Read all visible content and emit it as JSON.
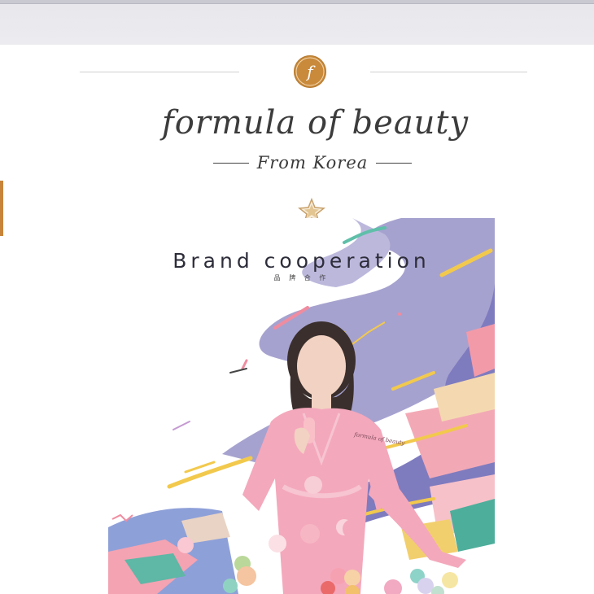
{
  "header": {
    "logo_letter": "f",
    "title": "formula of beauty",
    "subtitle": "From Korea"
  },
  "poster": {
    "heading": "Brand cooperation",
    "heading_cn": "品 牌 合 作",
    "robe_text": "formula of beauty"
  },
  "colors": {
    "accent": "#c8843a",
    "lavender": "#9b98c9",
    "pink": "#f3a8b8",
    "yellow": "#f2c94c"
  }
}
